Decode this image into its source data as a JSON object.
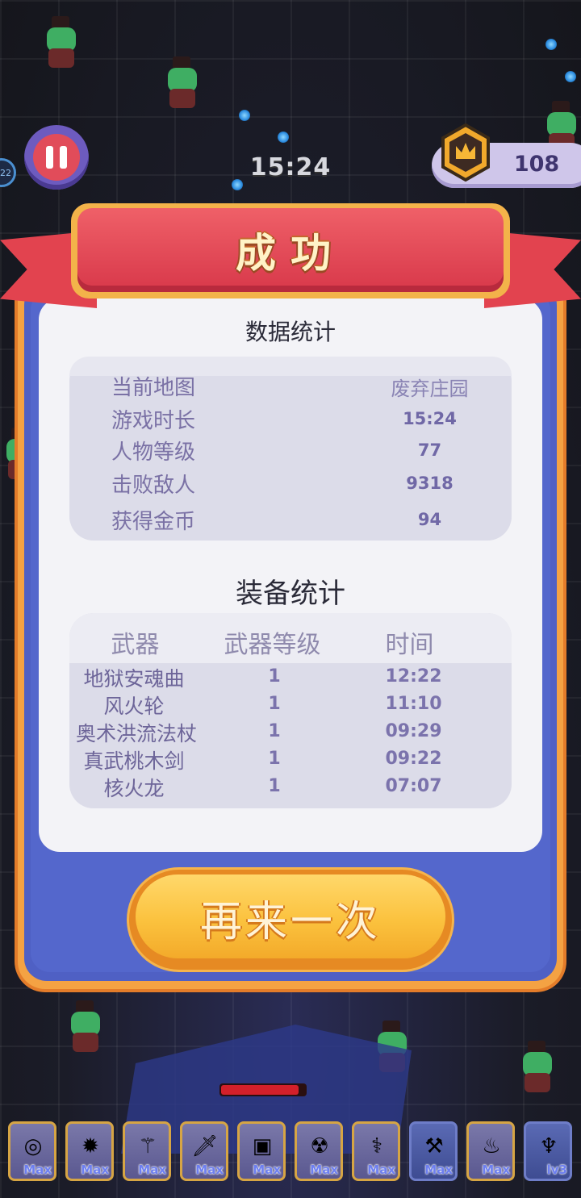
{
  "hud": {
    "timer": "15:24",
    "coins": "108",
    "side_badge": "22"
  },
  "result": {
    "title": "成功",
    "stats_title": "数据统计",
    "stats": [
      {
        "label": "当前地图",
        "value": "废弃庄园"
      },
      {
        "label": "游戏时长",
        "value": "15:24"
      },
      {
        "label": "人物等级",
        "value": "77"
      },
      {
        "label": "击败敌人",
        "value": "9318"
      },
      {
        "label": "获得金币",
        "value": "94"
      }
    ],
    "equip_title": "装备统计",
    "equip_columns": [
      "武器",
      "武器等级",
      "时间"
    ],
    "equip_rows": [
      {
        "weapon": "地狱安魂曲",
        "level": "1",
        "time": "12:22"
      },
      {
        "weapon": "风火轮",
        "level": "1",
        "time": "11:10"
      },
      {
        "weapon": "奥术洪流法杖",
        "level": "1",
        "time": "09:29"
      },
      {
        "weapon": "真武桃木剑",
        "level": "1",
        "time": "09:22"
      },
      {
        "weapon": "核火龙",
        "level": "1",
        "time": "07:07"
      }
    ],
    "again_label": "再来一次"
  },
  "skill_bar": [
    {
      "icon": "target-disc-icon",
      "glyph": "◎",
      "level": "Max"
    },
    {
      "icon": "spiked-wheel-icon",
      "glyph": "✹",
      "level": "Max"
    },
    {
      "icon": "magic-staff-icon",
      "glyph": "⚚",
      "level": "Max"
    },
    {
      "icon": "dagger-icon",
      "glyph": "🗡",
      "level": "Max"
    },
    {
      "icon": "treasure-box-icon",
      "glyph": "▣",
      "level": "Max"
    },
    {
      "icon": "cauldron-icon",
      "glyph": "☢",
      "level": "Max"
    },
    {
      "icon": "wand-icon",
      "glyph": "⚕",
      "level": "Max"
    },
    {
      "icon": "green-gun-icon",
      "glyph": "⚒",
      "level": "Max"
    },
    {
      "icon": "fire-torch-icon",
      "glyph": "♨",
      "level": "Max"
    },
    {
      "icon": "bat-wings-icon",
      "glyph": "♆",
      "level": "lv3"
    }
  ],
  "player_hp_fraction": 0.92,
  "colors": {
    "ribbon_red": "#e2434f",
    "frame_blue": "#4f60c4",
    "button_gold": "#fbc23e",
    "stat_text": "#7068a6"
  }
}
